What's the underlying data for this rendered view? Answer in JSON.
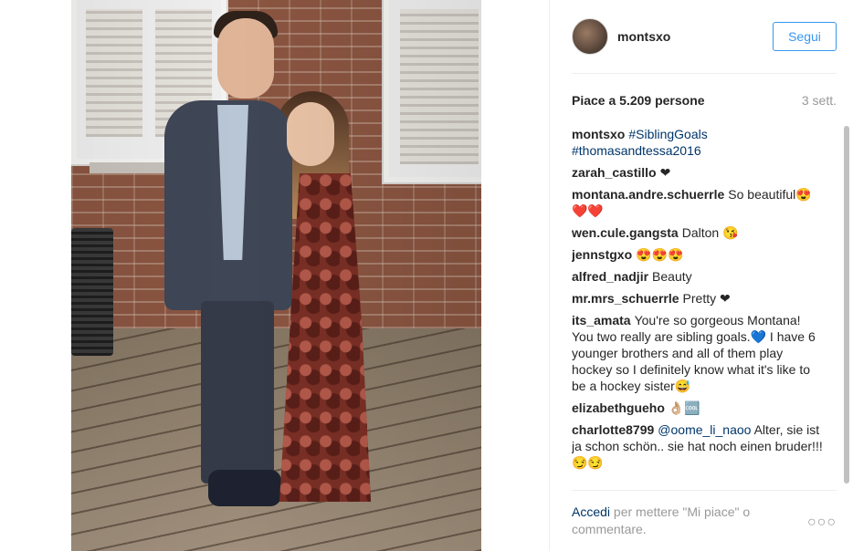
{
  "post": {
    "username": "montsxo",
    "follow_label": "Segui",
    "likes": "Piace a 5.209 persone",
    "time": "3 sett."
  },
  "comments": [
    {
      "author": "montsxo",
      "text": "",
      "link": "#SiblingGoals #thomasandtessa2016"
    },
    {
      "author": "zarah_castillo",
      "text": "❤",
      "link": ""
    },
    {
      "author": "montana.andre.schuerrle",
      "text": "So beautiful😍❤️❤️",
      "link": ""
    },
    {
      "author": "wen.cule.gangsta",
      "text": "Dalton 😘",
      "link": ""
    },
    {
      "author": "jennstgxo",
      "text": "😍😍😍",
      "link": ""
    },
    {
      "author": "alfred_nadjir",
      "text": "Beauty",
      "link": ""
    },
    {
      "author": "mr.mrs_schuerrle",
      "text": "Pretty ❤",
      "link": ""
    },
    {
      "author": "its_amata",
      "text": "You're so gorgeous Montana! You two really are sibling goals.💙 I have 6 younger brothers and all of them play hockey so I definitely know what it's like to be a hockey sister😅",
      "link": ""
    },
    {
      "author": "elizabethgueho",
      "text": "👌🏼🆒",
      "link": ""
    },
    {
      "author": "charlotte8799",
      "text": "Alter, sie ist ja schon schön.. sie hat noch einen bruder!!! 😏😏",
      "link": "@oome_li_naoo"
    }
  ],
  "footer": {
    "login": "Accedi",
    "rest": " per mettere \"Mi piace\" o commentare.",
    "more": "○○○"
  },
  "colors": {
    "accent": "#3897f0",
    "link": "#003569",
    "muted": "#999999",
    "text": "#262626"
  }
}
